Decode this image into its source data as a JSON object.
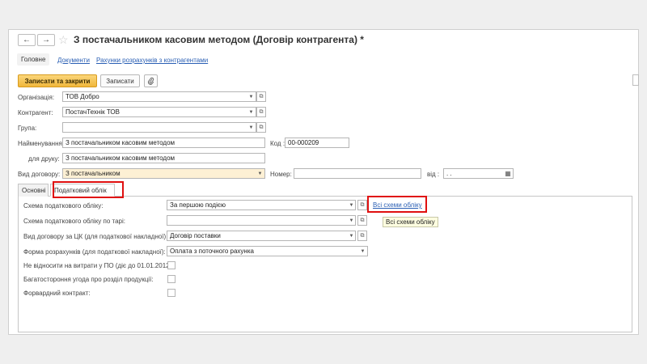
{
  "header": {
    "back_icon": "arrow-left-icon",
    "forward_icon": "arrow-right-icon",
    "favorite_icon": "star-icon",
    "title": "З постачальником касовим методом (Договір контрагента) *"
  },
  "tabs": [
    {
      "label": "Головне"
    },
    {
      "label": "Документи"
    },
    {
      "label": "Рахунки розрахунків з контрагентами"
    }
  ],
  "toolbar": {
    "save_close_label": "Записати та закрити",
    "save_label": "Записати",
    "attach_icon": "paperclip-icon"
  },
  "form": {
    "organization_label": "Організація:",
    "organization_value": "ТОВ Добро",
    "counterparty_label": "Контрагент:",
    "counterparty_value": "ПостачТехнік ТОВ",
    "group_label": "Група:",
    "group_value": "",
    "name_label": "Найменування:",
    "name_value": "З постачальником касовим методом",
    "code_label": "Код :",
    "code_value": "00-000209",
    "print_label": "для друку:",
    "print_value": "З постачальником касовим методом",
    "contract_type_label": "Вид договору:",
    "contract_type_value": "З постачальником",
    "number_label": "Номер:",
    "number_value": "",
    "date_label": "від :",
    "date_value": ". ."
  },
  "subtabs": [
    {
      "label": "Основні"
    },
    {
      "label": "Податковий облік"
    }
  ],
  "tax": {
    "scheme_label": "Схема податкового обліку:",
    "scheme_value": "За першою подією",
    "scheme_tare_label": "Схема податкового обліку по тарі:",
    "scheme_tare_value": "",
    "contract_kind_label": "Вид договору за ЦК (для податкової накладної):",
    "contract_kind_value": "Договір поставки",
    "payment_form_label": "Форма розрахунків (для податкової накладної):",
    "payment_form_value": "Оплата з поточного рахунка",
    "no_expense_label": "Не відносити на витрати у ПО (діє до 01.01.2012):",
    "multilateral_label": "Багатостороння угода про розділ продукції:",
    "forward_label": "Форвардний контракт:",
    "all_schemes_link": "Всі схеми обліку",
    "all_schemes_tooltip": "Всі схеми обліку"
  },
  "colors": {
    "primary_button": "#f0b73c",
    "highlight": "#e01010",
    "link": "#2a5fb4",
    "required_field": "#fdf0d4"
  }
}
